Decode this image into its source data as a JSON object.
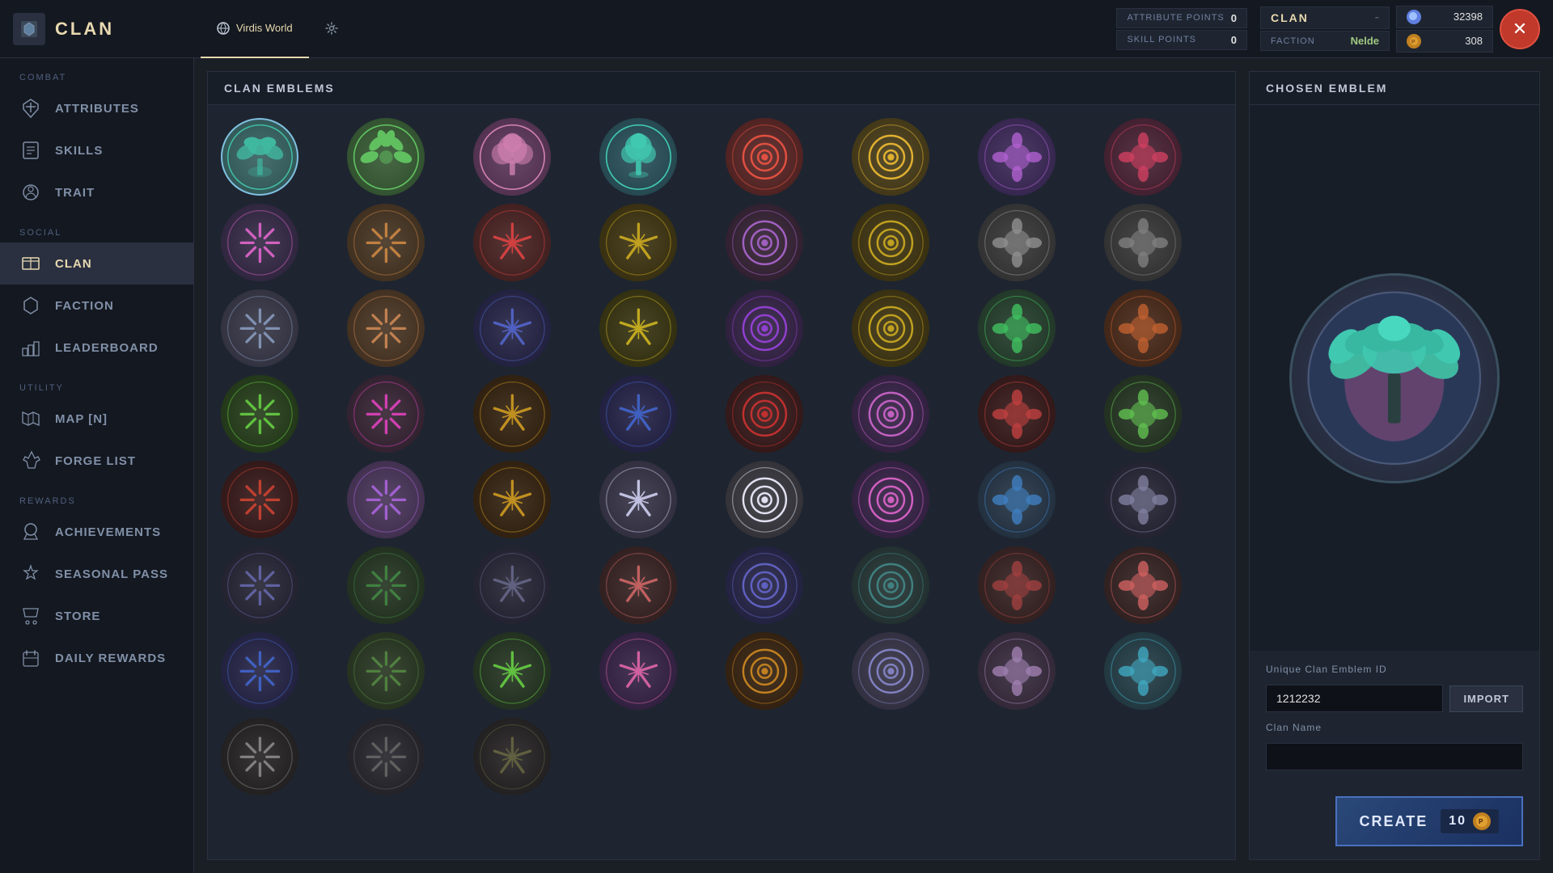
{
  "topBar": {
    "title": "CLAN",
    "tabs": [
      {
        "label": "Virdis World",
        "icon": "globe",
        "active": true
      },
      {
        "label": "Settings",
        "icon": "gear",
        "active": false
      }
    ],
    "stats": {
      "attributePoints": {
        "label": "ATTRIBUTE POINTS",
        "value": "0"
      },
      "skillPoints": {
        "label": "SKILL POINTS",
        "value": "0"
      }
    },
    "clan": {
      "label": "CLAN",
      "value": "CLAN",
      "minus": "-"
    },
    "faction": {
      "label": "FACTION",
      "value": "Nelde"
    },
    "currencies": [
      {
        "value": "32398"
      },
      {
        "value": "308"
      }
    ],
    "closeButton": "✕"
  },
  "sidebar": {
    "sections": [
      {
        "label": "COMBAT",
        "items": [
          {
            "id": "attributes",
            "label": "ATTRIBUTES",
            "icon": "⚔"
          },
          {
            "id": "skills",
            "label": "SKILLS",
            "icon": "📖"
          },
          {
            "id": "trait",
            "label": "TRAIT",
            "icon": "🎭"
          }
        ]
      },
      {
        "label": "SOCIAL",
        "items": [
          {
            "id": "clan",
            "label": "CLAN",
            "icon": "🛡",
            "active": true
          },
          {
            "id": "faction",
            "label": "FACTION",
            "icon": "👥"
          },
          {
            "id": "leaderboard",
            "label": "LEADERBOARD",
            "icon": "🏆"
          }
        ]
      },
      {
        "label": "UTILITY",
        "items": [
          {
            "id": "map",
            "label": "MAP [N]",
            "icon": "🗺"
          },
          {
            "id": "forgelist",
            "label": "FORGE LIST",
            "icon": "🔨"
          }
        ]
      },
      {
        "label": "REWARDS",
        "items": [
          {
            "id": "achievements",
            "label": "ACHIEVEMENTS",
            "icon": "🎖"
          },
          {
            "id": "seasonalpass",
            "label": "SEASONAL PASS",
            "icon": "🗡"
          },
          {
            "id": "store",
            "label": "STORE",
            "icon": "🛒"
          },
          {
            "id": "dailyrewards",
            "label": "DAILY REWARDS",
            "icon": "📅"
          }
        ]
      }
    ]
  },
  "emblemsPanel": {
    "header": "CLAN EMBLEMS",
    "selectedIndex": 0
  },
  "rightPanel": {
    "header": "CHOSEN EMBLEM",
    "uniqueIdLabel": "Unique Clan Emblem ID",
    "uniqueIdValue": "1212232",
    "importLabel": "Import",
    "clanNameLabel": "Clan Name",
    "clanNameValue": "",
    "clanNamePlaceholder": "",
    "createLabel": "CREATE",
    "createCost": "10"
  }
}
